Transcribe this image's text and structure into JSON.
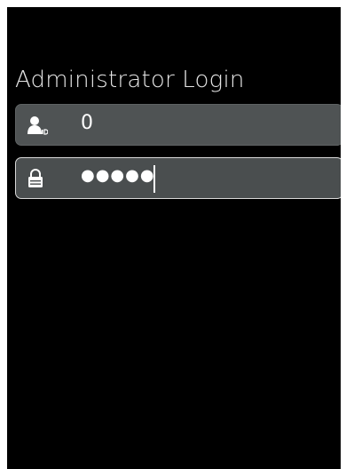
{
  "screen": {
    "title": "Administrator Login"
  },
  "user_field": {
    "icon": "user-id-icon",
    "value": "0"
  },
  "password_field": {
    "icon": "lock-icon",
    "value": "●●●●●"
  },
  "colors": {
    "background": "#000000",
    "field": "#4f5354",
    "text": "#ffffff",
    "focus_border": "#d8d8d8"
  }
}
